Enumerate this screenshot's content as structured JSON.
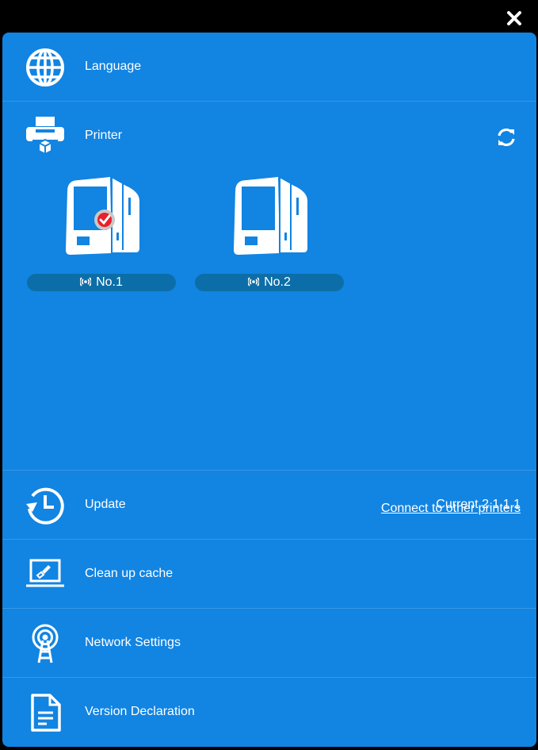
{
  "close": {
    "icon": "close-icon"
  },
  "menu": {
    "language": {
      "label": "Language",
      "icon": "globe-icon"
    },
    "printer": {
      "label": "Printer",
      "icon": "printer-icon",
      "refresh_icon": "refresh-icon"
    },
    "update": {
      "label": "Update",
      "status": "Current 2.1.1.1",
      "icon": "history-clock-icon"
    },
    "cache": {
      "label": "Clean up cache",
      "icon": "laptop-brush-icon"
    },
    "network": {
      "label": "Network Settings",
      "icon": "antenna-icon"
    },
    "version": {
      "label": "Version Declaration",
      "icon": "document-icon"
    }
  },
  "printers": [
    {
      "name": "No.1",
      "selected": true
    },
    {
      "name": "No.2",
      "selected": false
    }
  ],
  "connect_link": "Connect to other printers",
  "colors": {
    "panel": "#1284e2",
    "pill": "#0c6ea8",
    "check": "#e8202a"
  }
}
